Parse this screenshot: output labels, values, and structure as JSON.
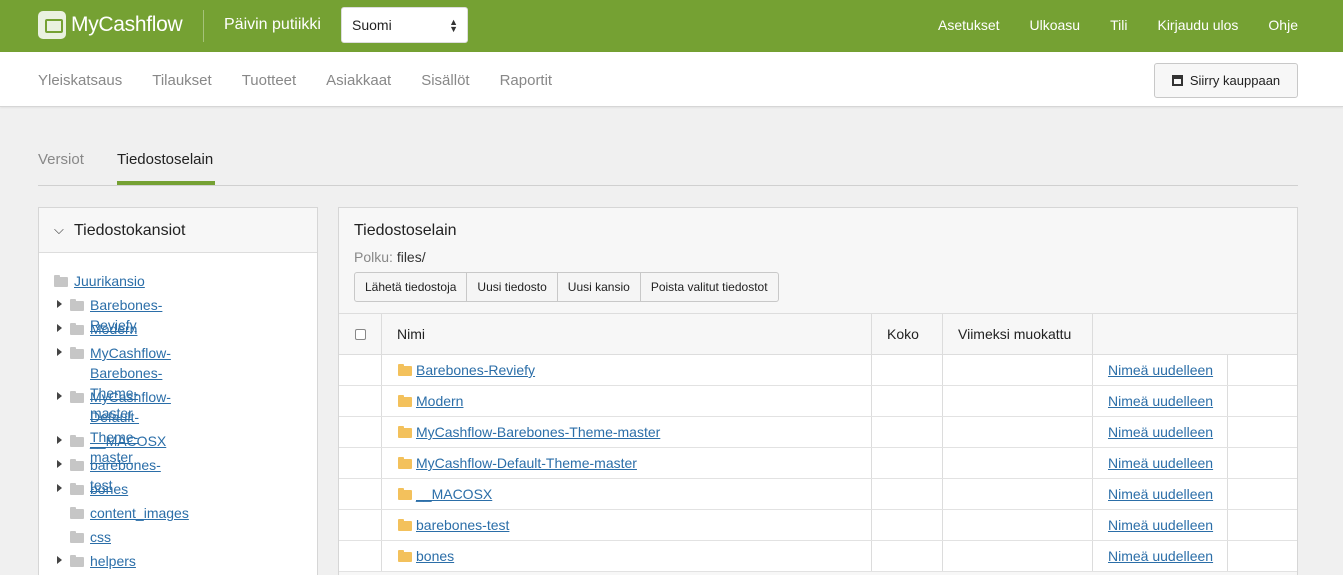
{
  "header": {
    "logo_text": "MyCashflow",
    "shop_name": "Päivin putiikki",
    "language": "Suomi",
    "nav": [
      "Asetukset",
      "Ulkoasu",
      "Tili",
      "Kirjaudu ulos",
      "Ohje"
    ]
  },
  "main_nav": {
    "items": [
      "Yleiskatsaus",
      "Tilaukset",
      "Tuotteet",
      "Asiakkaat",
      "Sisällöt",
      "Raportit"
    ],
    "store_button": "Siirry kauppaan"
  },
  "tabs": [
    "Versiot",
    "Tiedostoselain"
  ],
  "folders_panel": {
    "title": "Tiedostokansiot",
    "root": "Juurikansio",
    "items": [
      {
        "label": "Barebones-Reviefy",
        "expandable": true
      },
      {
        "label": "Modern",
        "expandable": true
      },
      {
        "label": "MyCashflow-Barebones-Theme-master",
        "line1": "MyCashflow-Barebones-Theme-",
        "line2": "master",
        "expandable": true
      },
      {
        "label": "MyCashflow-Default-Theme-master",
        "line1": "MyCashflow-Default-Theme-",
        "line2": "master",
        "expandable": true
      },
      {
        "label": "__MACOSX",
        "expandable": true
      },
      {
        "label": "barebones-test",
        "expandable": true
      },
      {
        "label": "bones",
        "expandable": true
      },
      {
        "label": "content_images",
        "expandable": false
      },
      {
        "label": "css",
        "expandable": false
      },
      {
        "label": "helpers",
        "expandable": true
      }
    ]
  },
  "browser": {
    "title": "Tiedostoselain",
    "path_label": "Polku:",
    "path_value": "files/",
    "buttons": [
      "Lähetä tiedostoja",
      "Uusi tiedosto",
      "Uusi kansio",
      "Poista valitut tiedostot"
    ],
    "columns": [
      "Nimi",
      "Koko",
      "Viimeksi muokattu"
    ],
    "rename_label": "Nimeä uudelleen",
    "rows": [
      "Barebones-Reviefy",
      "Modern",
      "MyCashflow-Barebones-Theme-master",
      "MyCashflow-Default-Theme-master",
      "__MACOSX",
      "barebones-test",
      "bones"
    ]
  },
  "colors": {
    "brand_green": "#75a133",
    "link_blue": "#2b6ea8",
    "folder_yellow": "#f3c15c"
  }
}
